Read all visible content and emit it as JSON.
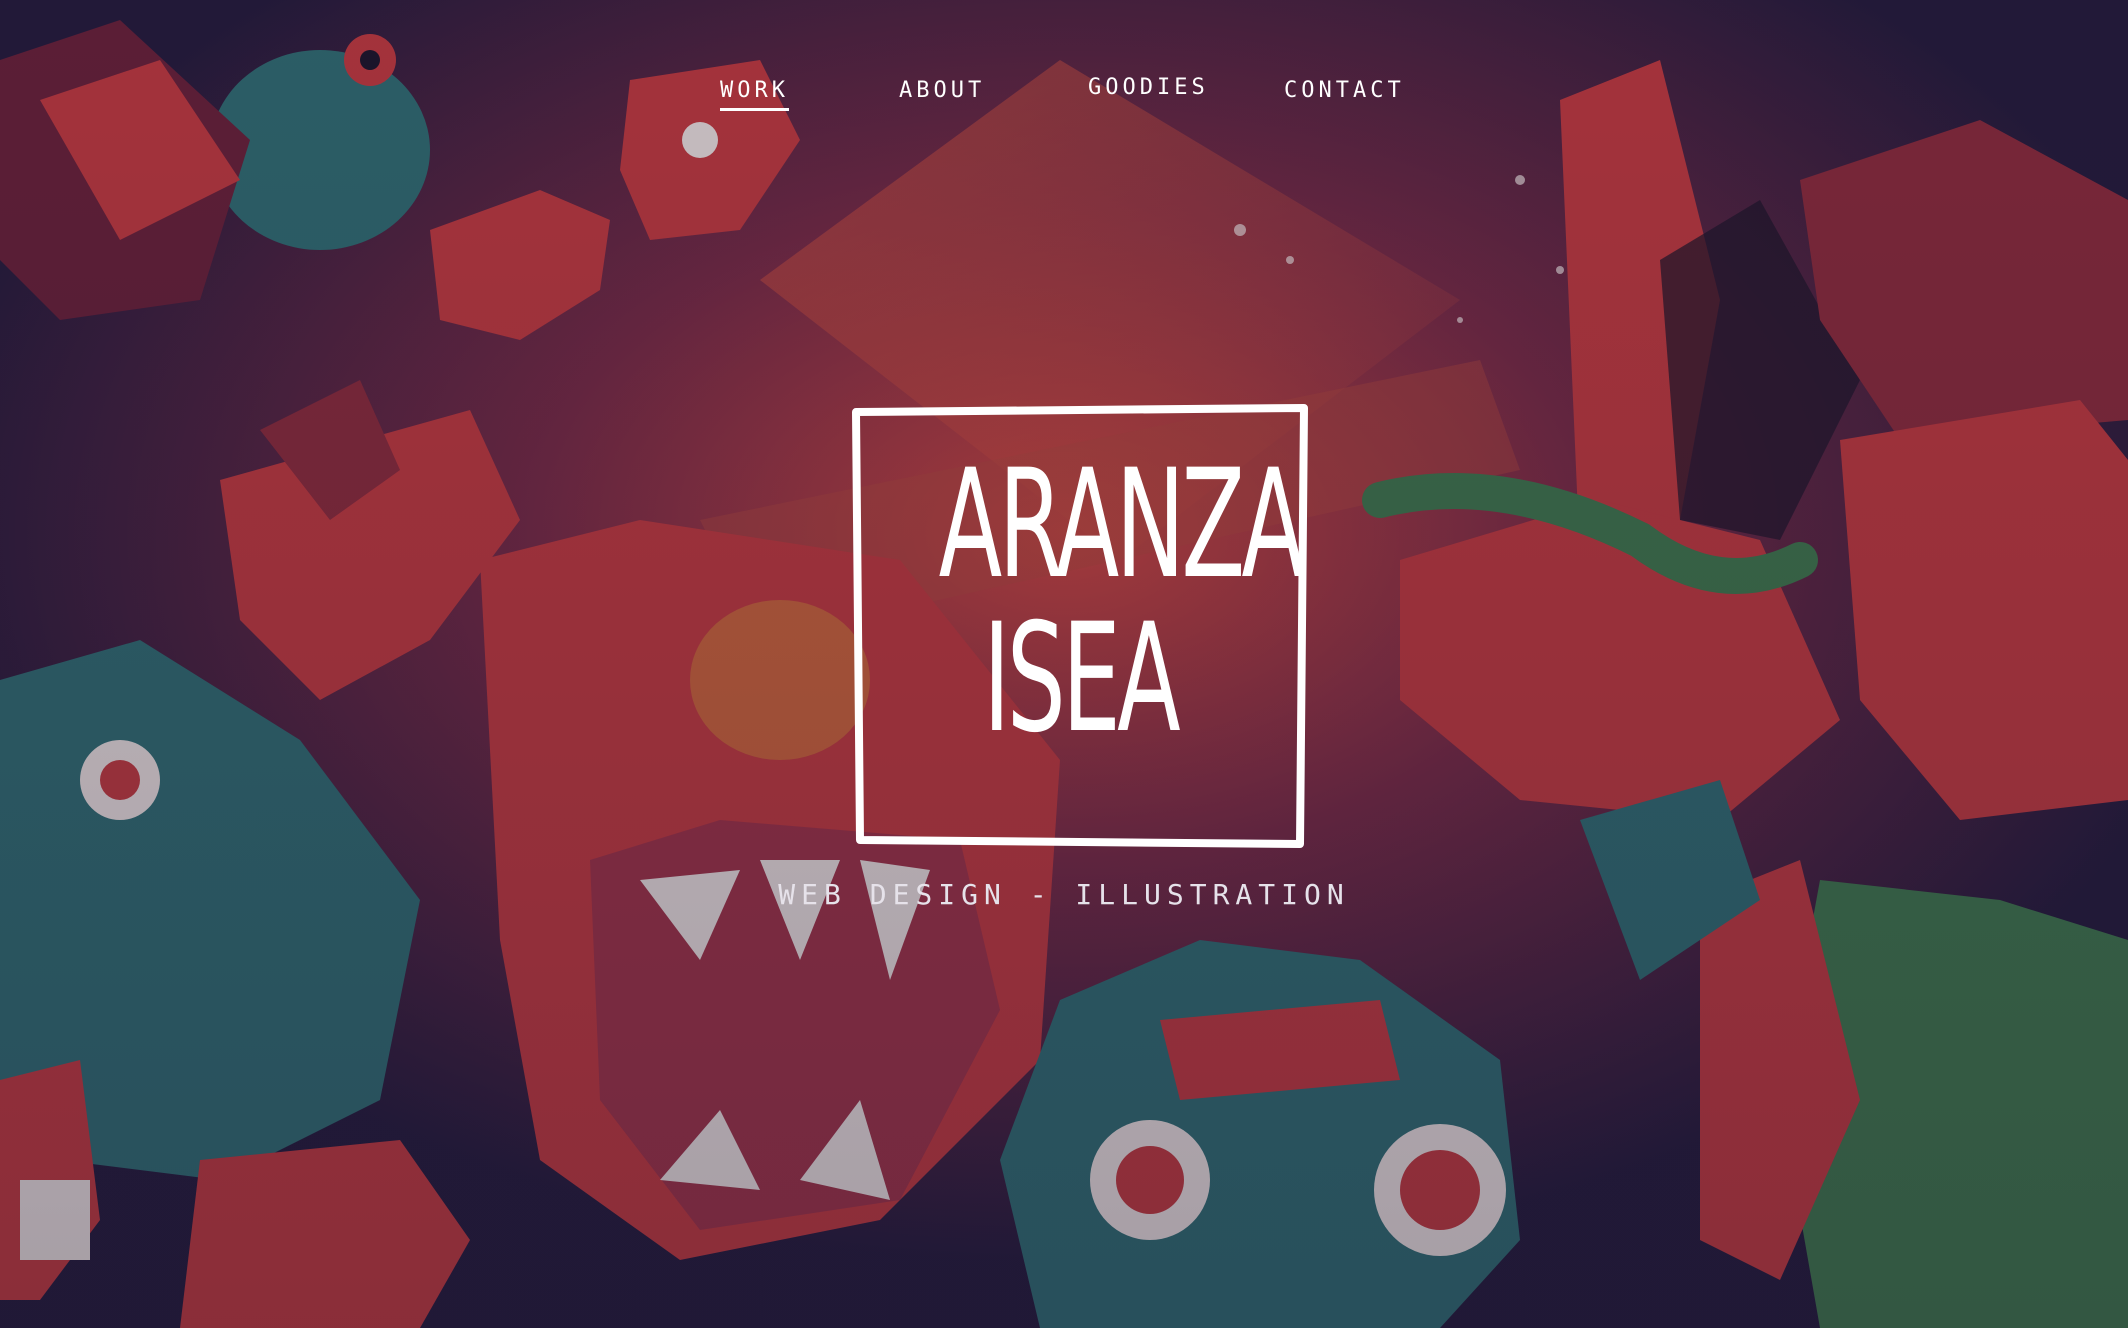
{
  "nav": {
    "items": [
      {
        "label": "WORK",
        "active": true
      },
      {
        "label": "ABOUT",
        "active": false
      },
      {
        "label": "GOODIES",
        "active": false
      },
      {
        "label": "CONTACT",
        "active": false
      }
    ]
  },
  "logo": {
    "line1": "ARANZA",
    "line2": "ISEA"
  },
  "tagline": "WEB DESIGN - ILLUSTRATION",
  "colors": {
    "background_dark": "#241d3d",
    "accent_red": "#c63a3e",
    "accent_teal": "#2f6f73",
    "accent_green": "#3f7a4c",
    "text": "#ffffff"
  }
}
